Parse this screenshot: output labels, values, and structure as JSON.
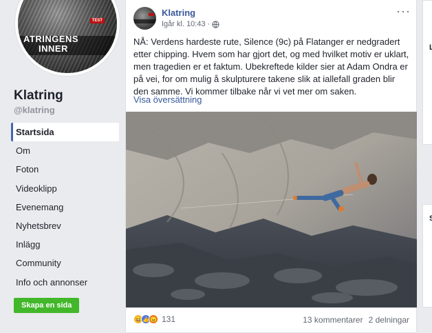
{
  "page": {
    "name": "Klatring",
    "handle": "@klatring",
    "cover_text_line1": "ATRINGENS",
    "cover_text_line2": "INNER",
    "cover_badge": "TEST"
  },
  "nav": {
    "items": [
      {
        "label": "Startsida",
        "active": true
      },
      {
        "label": "Om"
      },
      {
        "label": "Foton"
      },
      {
        "label": "Videoklipp"
      },
      {
        "label": "Evenemang"
      },
      {
        "label": "Nyhetsbrev"
      },
      {
        "label": "Inlägg"
      },
      {
        "label": "Community"
      },
      {
        "label": "Info och annonser"
      }
    ],
    "create_page_button": "Skapa en sida"
  },
  "post": {
    "author": "Klatring",
    "time": "Igår kl. 10:43",
    "audience_icon": "globe-icon",
    "text": "NÅ: Verdens hardeste rute, Silence (9c) på Flatanger er nedgradert etter chipping. Hvem som har gjort det, og med hvilket motiv er uklart, men tragedien er et faktum. Ubekreftede kilder sier at Adam Ondra er på vei, for om mulig å skulpturere takene slik at iallefall graden blir den samme. Vi kommer tilbake når vi vet mer om saken.",
    "translate": "Visa översättning",
    "reaction_count": "131",
    "comments": "13 kommentarer",
    "shares": "2 delningar"
  },
  "right": {
    "card1_letter": "L",
    "card2_letter": "S"
  },
  "colors": {
    "link": "#365899",
    "nav_active_border": "#4267b2",
    "create_button": "#42b72a",
    "background": "#e9ebee"
  }
}
